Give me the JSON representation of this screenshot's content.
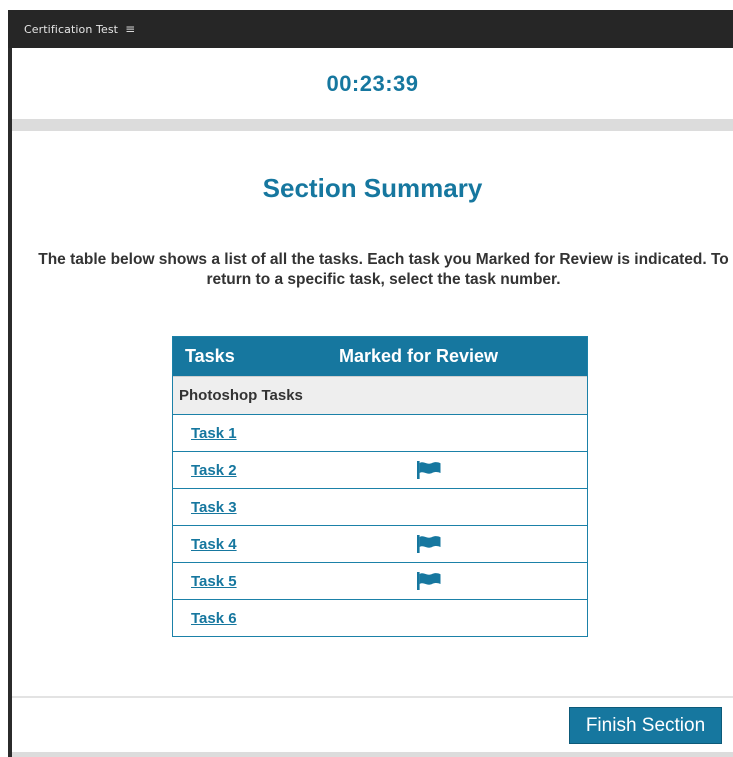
{
  "window": {
    "title": "Certification Test",
    "menu_icon": "hamburger-menu-icon"
  },
  "timer": {
    "value": "00:23:39"
  },
  "section": {
    "heading": "Section Summary",
    "instructions": "The table below shows a list of all the tasks. Each task you Marked for Review is indicated. To return to a specific task, select the task number."
  },
  "table": {
    "columns": [
      "Tasks",
      "Marked for Review"
    ],
    "group_label": "Photoshop Tasks",
    "rows": [
      {
        "label": "Task 1",
        "marked": false
      },
      {
        "label": "Task 2",
        "marked": true
      },
      {
        "label": "Task 3",
        "marked": false
      },
      {
        "label": "Task 4",
        "marked": true
      },
      {
        "label": "Task 5",
        "marked": true
      },
      {
        "label": "Task 6",
        "marked": false
      }
    ],
    "flag_icon": "flag-icon"
  },
  "footer": {
    "finish_label": "Finish Section"
  },
  "colors": {
    "accent": "#16779f",
    "titlebar": "#262626",
    "group_row": "#eeeeee"
  }
}
